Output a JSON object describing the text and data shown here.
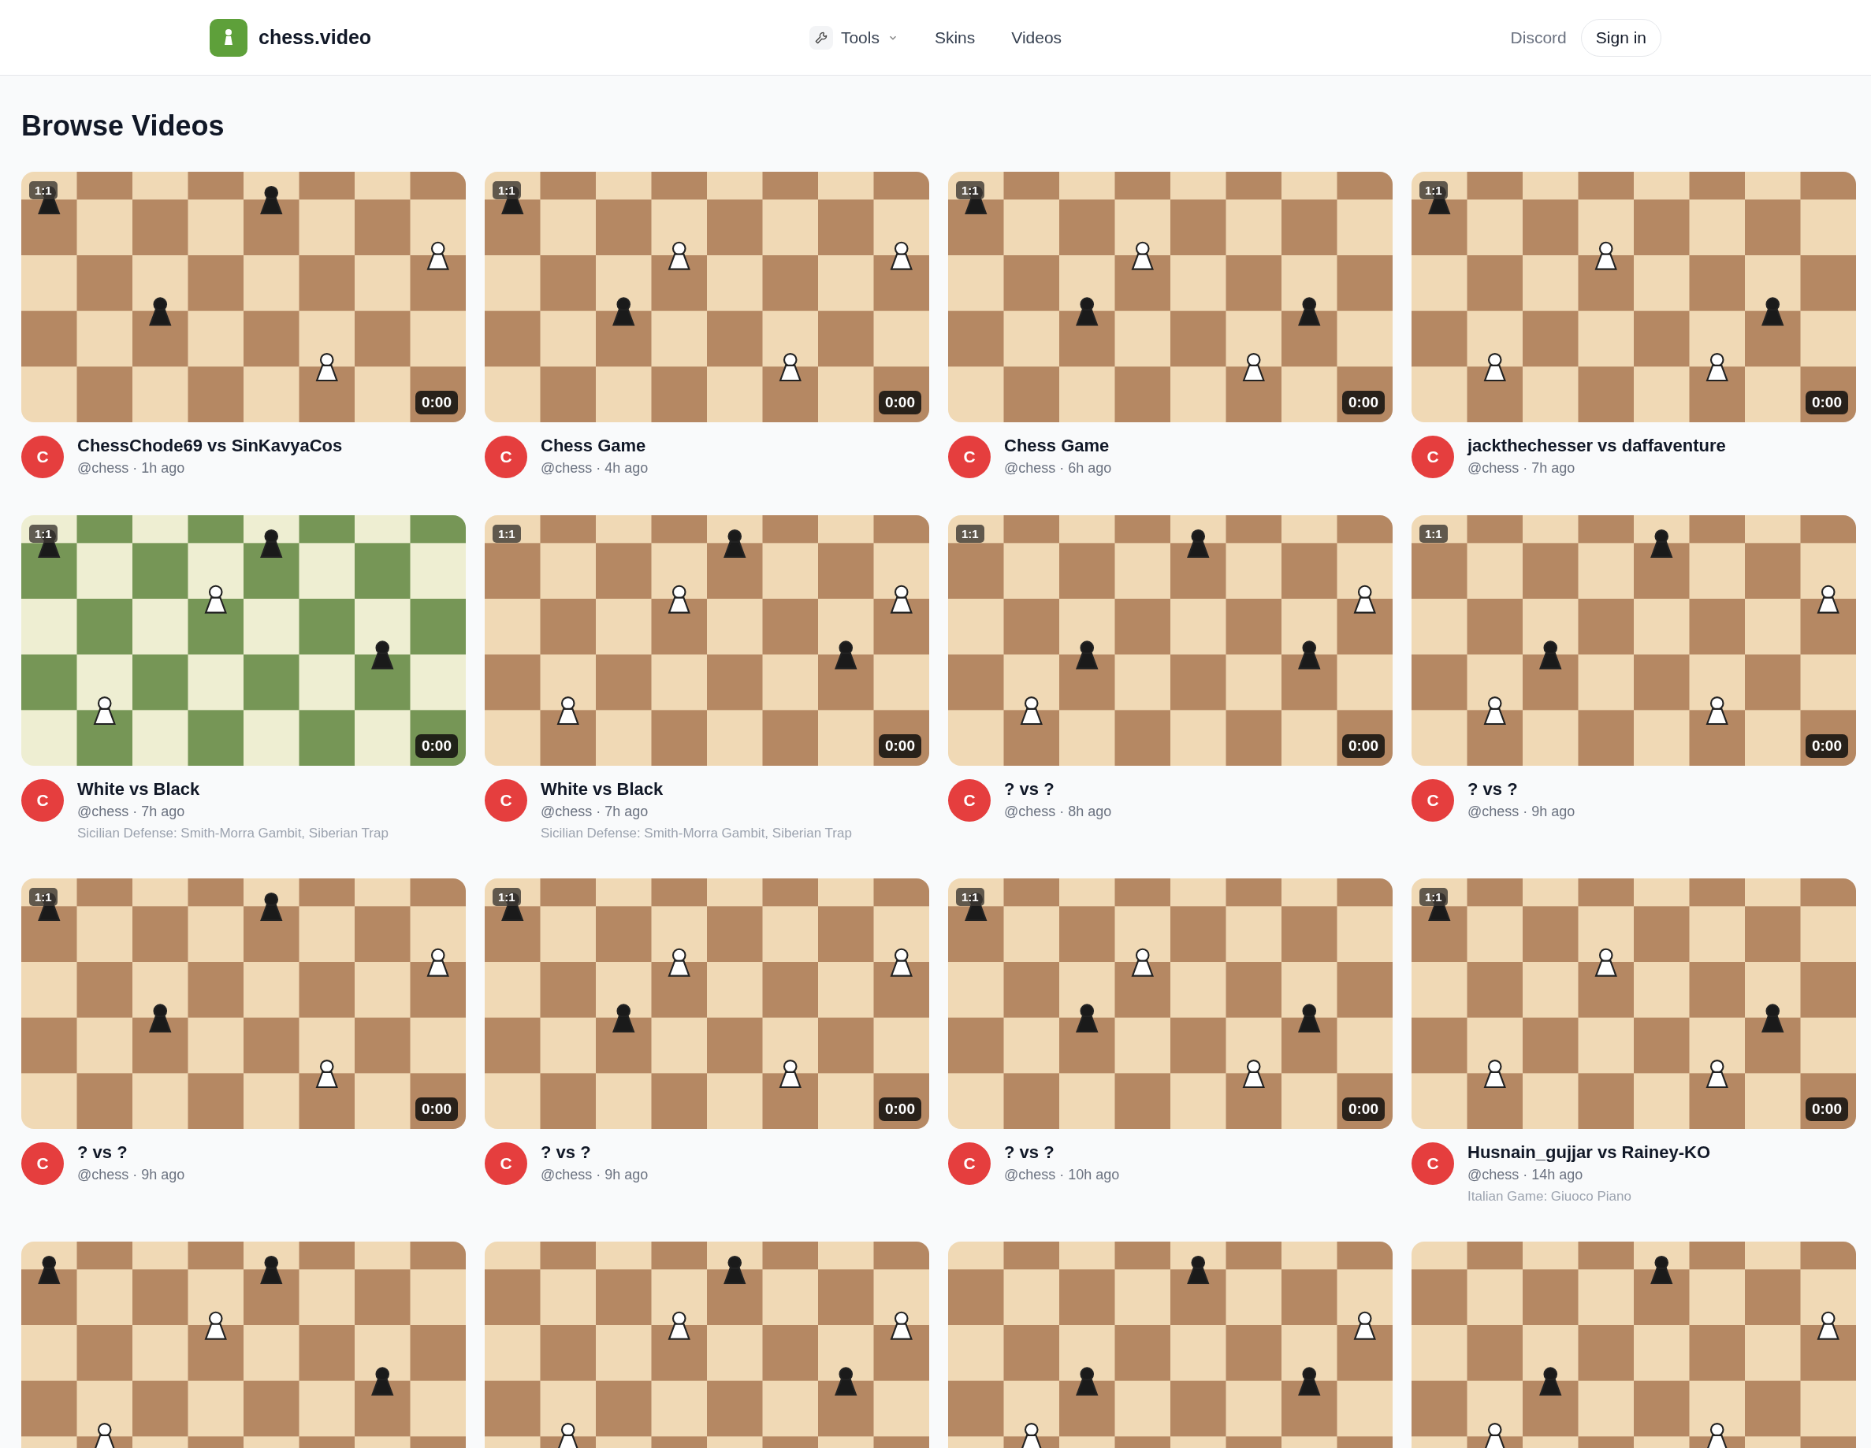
{
  "header": {
    "logo_text": "chess.video",
    "nav": [
      {
        "label": "Tools",
        "kind": "menu"
      },
      {
        "label": "Skins",
        "kind": "link"
      },
      {
        "label": "Videos",
        "kind": "link"
      }
    ],
    "discord": "Discord",
    "sign_in": "Sign in"
  },
  "page_title": "Browse Videos",
  "videos": [
    {
      "kind": "picture",
      "ratio": "1:1",
      "duration": "0:00",
      "avatar": "C",
      "title": "ChessChode69 vs SinKavyaCos",
      "meta": "@chess · 1h ago"
    },
    {
      "kind": "picture",
      "ratio": "1:1",
      "duration": "0:00",
      "avatar": "C",
      "title": "Chess Game",
      "meta": "@chess · 4h ago"
    },
    {
      "kind": "picture",
      "ratio": "1:1",
      "duration": "0:00",
      "avatar": "C",
      "title": "Chess Game",
      "meta": "@chess · 6h ago"
    },
    {
      "kind": "picture",
      "ratio": "1:1",
      "duration": "0:00",
      "avatar": "C",
      "title": "jackthechesser vs daffaventure",
      "meta": "@chess · 7h ago"
    },
    {
      "kind": "picture",
      "ratio": "1:1",
      "duration": "0:00",
      "avatar": "C",
      "title": "White vs Black",
      "meta": "@chess · 7h ago",
      "opening": "Sicilian Defense: Smith-Morra Gambit, Siberian Trap"
    },
    {
      "kind": "picture",
      "ratio": "1:1",
      "duration": "0:00",
      "avatar": "C",
      "title": "White vs Black",
      "meta": "@chess · 7h ago",
      "opening": "Sicilian Defense: Smith-Morra Gambit, Siberian Trap"
    },
    {
      "kind": "picture",
      "ratio": "1:1",
      "duration": "0:00",
      "avatar": "C",
      "title": "? vs ?",
      "meta": "@chess · 8h ago"
    },
    {
      "kind": "picture",
      "ratio": "1:1",
      "duration": "0:00",
      "avatar": "C",
      "title": "? vs ?",
      "meta": "@chess · 9h ago"
    },
    {
      "kind": "picture",
      "ratio": "1:1",
      "duration": "0:00",
      "avatar": "C",
      "title": "? vs ?",
      "meta": "@chess · 9h ago"
    },
    {
      "kind": "picture",
      "ratio": "1:1",
      "duration": "0:00",
      "avatar": "C",
      "title": "? vs ?",
      "meta": "@chess · 9h ago"
    },
    {
      "kind": "picture",
      "ratio": "1:1",
      "duration": "0:00",
      "avatar": "C",
      "title": "? vs ?",
      "meta": "@chess · 10h ago"
    },
    {
      "kind": "picture",
      "ratio": "1:1",
      "duration": "0:00",
      "avatar": "C",
      "title": "Husnain_gujjar vs Rainey-KO",
      "meta": "@chess · 14h ago",
      "opening": "Italian Game: Giuoco Piano"
    },
    {
      "kind": "picture"
    },
    {
      "kind": "picture"
    },
    {
      "kind": "picture"
    },
    {
      "kind": "picture"
    }
  ]
}
